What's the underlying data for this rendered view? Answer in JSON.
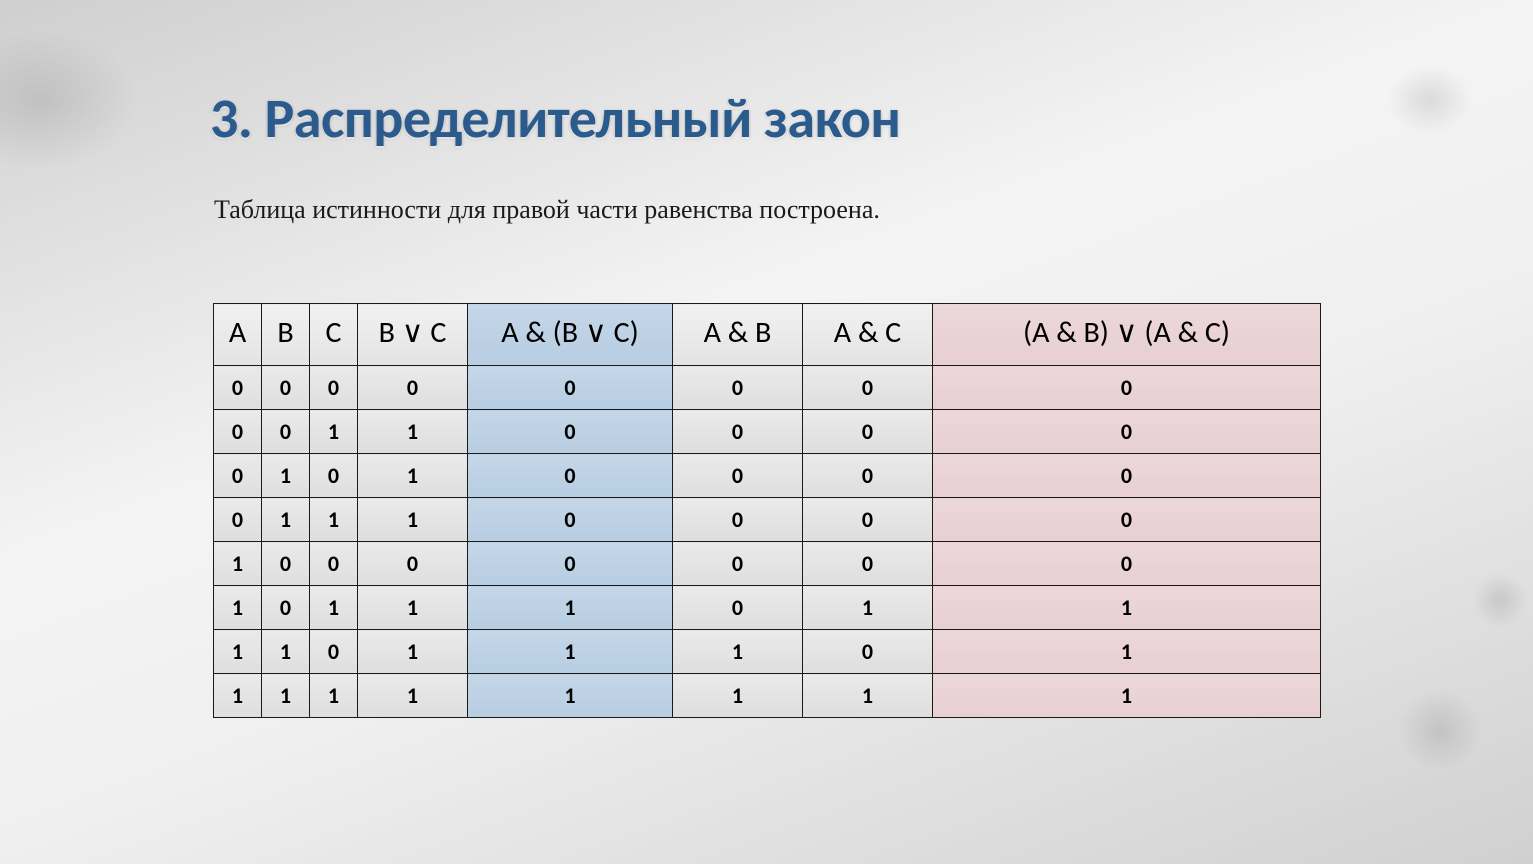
{
  "title": "3. Распределительный закон",
  "subtitle": "Таблица истинности для правой части равенства построена.",
  "table": {
    "headers": [
      "A",
      "B",
      "C",
      "B ∨ C",
      "A & (B ∨ C)",
      "A & B",
      "A & C",
      "(A & B) ∨ (A & C)"
    ],
    "rows": [
      [
        "0",
        "0",
        "0",
        "0",
        "0",
        "0",
        "0",
        "0"
      ],
      [
        "0",
        "0",
        "1",
        "1",
        "0",
        "0",
        "0",
        "0"
      ],
      [
        "0",
        "1",
        "0",
        "1",
        "0",
        "0",
        "0",
        "0"
      ],
      [
        "0",
        "1",
        "1",
        "1",
        "0",
        "0",
        "0",
        "0"
      ],
      [
        "1",
        "0",
        "0",
        "0",
        "0",
        "0",
        "0",
        "0"
      ],
      [
        "1",
        "0",
        "1",
        "1",
        "1",
        "0",
        "1",
        "1"
      ],
      [
        "1",
        "1",
        "0",
        "1",
        "1",
        "1",
        "0",
        "1"
      ],
      [
        "1",
        "1",
        "1",
        "1",
        "1",
        "1",
        "1",
        "1"
      ]
    ],
    "highlight_blue_col": 4,
    "highlight_pink_col": 7
  }
}
